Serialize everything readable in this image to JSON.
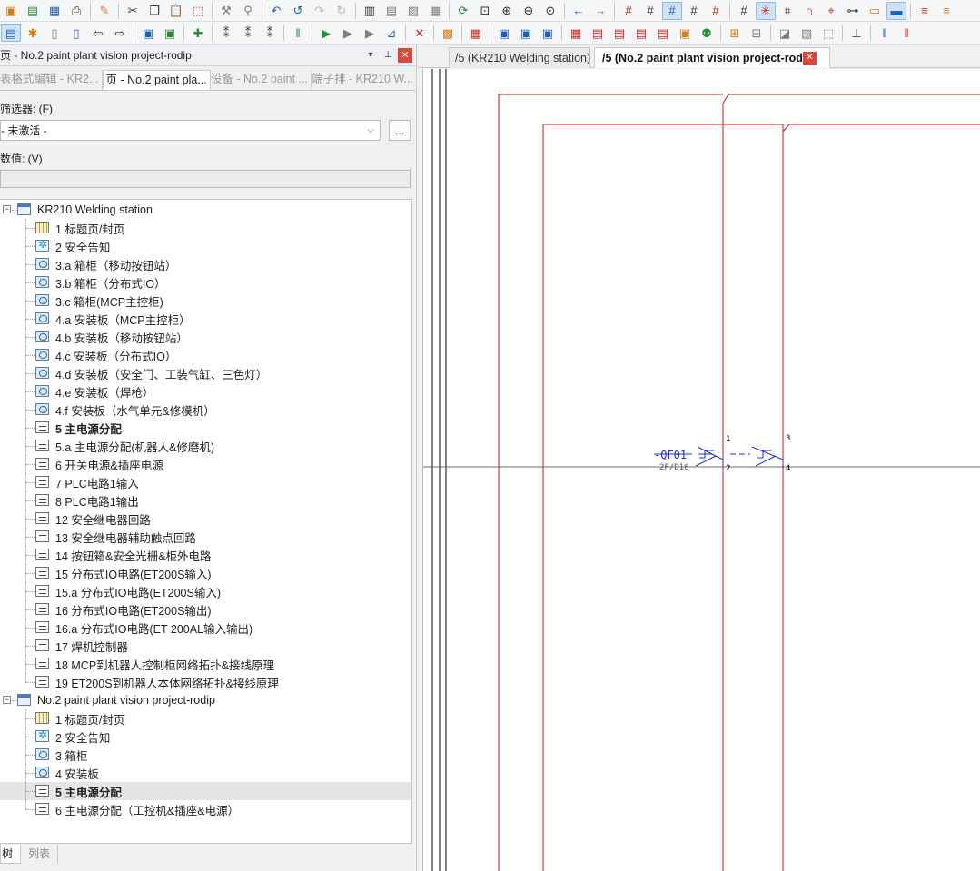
{
  "toolbar1": {
    "icons": [
      {
        "name": "new-project-icon",
        "glyph": "▣",
        "color": "c-orange"
      },
      {
        "name": "open-project-icon",
        "glyph": "▤",
        "color": "c-green"
      },
      {
        "name": "save-icon",
        "glyph": "▦",
        "color": "c-blue"
      },
      {
        "name": "print-icon",
        "glyph": "⎙",
        "color": "c-dark"
      },
      {
        "sep": true
      },
      {
        "name": "settings-wrench-icon",
        "glyph": "✎",
        "color": "c-orange"
      },
      {
        "sep": true
      },
      {
        "name": "cut-icon",
        "glyph": "✂",
        "color": "c-dark"
      },
      {
        "name": "copy-icon",
        "glyph": "❐",
        "color": "c-dark"
      },
      {
        "name": "paste-icon",
        "glyph": "📋",
        "color": "c-orange"
      },
      {
        "name": "delete-selection-icon",
        "glyph": "⬚",
        "color": "c-red"
      },
      {
        "sep": true
      },
      {
        "name": "format-paint-icon",
        "glyph": "⚒",
        "color": "c-gray"
      },
      {
        "name": "brush-icon",
        "glyph": "⚲",
        "color": "c-gray"
      },
      {
        "sep": true
      },
      {
        "name": "undo-icon",
        "glyph": "↶",
        "color": "c-blue"
      },
      {
        "name": "undo-list-icon",
        "glyph": "↺",
        "color": "c-blue"
      },
      {
        "name": "redo-icon",
        "glyph": "↷",
        "color": "c-lgray"
      },
      {
        "name": "redo-list-icon",
        "glyph": "↻",
        "color": "c-lgray"
      },
      {
        "sep": true
      },
      {
        "name": "page-layout-icon",
        "glyph": "▥",
        "color": "c-dark"
      },
      {
        "name": "page-copy-icon",
        "glyph": "▤",
        "color": "c-gray"
      },
      {
        "name": "page-properties-icon",
        "glyph": "▨",
        "color": "c-gray"
      },
      {
        "name": "table-icon",
        "glyph": "▦",
        "color": "c-gray"
      },
      {
        "sep": true
      },
      {
        "name": "refresh-icon",
        "glyph": "⟳",
        "color": "c-green"
      },
      {
        "name": "zoom-window-icon",
        "glyph": "⊡",
        "color": "c-dark"
      },
      {
        "name": "zoom-in-icon",
        "glyph": "⊕",
        "color": "c-dark"
      },
      {
        "name": "zoom-out-icon",
        "glyph": "⊖",
        "color": "c-dark"
      },
      {
        "name": "zoom-100-icon",
        "glyph": "⊙",
        "color": "c-dark"
      },
      {
        "sep": true
      },
      {
        "name": "back-arrow-icon",
        "glyph": "←",
        "color": "c-blue"
      },
      {
        "name": "forward-arrow-icon",
        "glyph": "→",
        "color": "c-gray"
      },
      {
        "sep": true
      },
      {
        "name": "grid-a-icon",
        "glyph": "#",
        "color": "c-red"
      },
      {
        "name": "grid-b-icon",
        "glyph": "#",
        "color": "c-dark"
      },
      {
        "name": "grid-c-icon",
        "glyph": "#",
        "color": "c-blue",
        "active": true
      },
      {
        "name": "grid-d-icon",
        "glyph": "#",
        "color": "c-dark"
      },
      {
        "name": "grid-e-icon",
        "glyph": "#",
        "color": "c-red"
      },
      {
        "sep": true
      },
      {
        "name": "snap-grid-icon",
        "glyph": "#",
        "color": "c-dark"
      },
      {
        "name": "snap-object-icon",
        "glyph": "✳",
        "color": "c-red",
        "active": true
      },
      {
        "name": "intersection-icon",
        "glyph": "⌗",
        "color": "c-dark"
      },
      {
        "name": "magnet-icon",
        "glyph": "∩",
        "color": "c-red"
      },
      {
        "name": "input-assist-icon",
        "glyph": "⌖",
        "color": "c-red"
      },
      {
        "name": "connection-icon",
        "glyph": "⊶",
        "color": "c-dark"
      },
      {
        "name": "label-icon",
        "glyph": "▭",
        "color": "c-orange"
      },
      {
        "name": "ortho-icon",
        "glyph": "▬",
        "color": "c-blue",
        "active": true
      },
      {
        "sep": true
      },
      {
        "name": "wires-icon",
        "glyph": "≡",
        "color": "c-red"
      },
      {
        "name": "more-icon",
        "glyph": "≡",
        "color": "c-orange"
      }
    ]
  },
  "toolbar2": {
    "icons": [
      {
        "name": "page-navigator-icon",
        "glyph": "▤",
        "color": "c-blue",
        "active": true
      },
      {
        "name": "new-page-icon",
        "glyph": "✱",
        "color": "c-orange"
      },
      {
        "name": "page-icon",
        "glyph": "▯",
        "color": "c-gray"
      },
      {
        "name": "page-edit-icon",
        "glyph": "▯",
        "color": "c-blue"
      },
      {
        "name": "previous-page-icon",
        "glyph": "⇦",
        "color": "c-dark"
      },
      {
        "name": "next-page-icon",
        "glyph": "⇨",
        "color": "c-dark"
      },
      {
        "sep": true
      },
      {
        "name": "layout-a-icon",
        "glyph": "▣",
        "color": "c-blue"
      },
      {
        "name": "layout-b-icon",
        "glyph": "▣",
        "color": "c-green"
      },
      {
        "sep": true
      },
      {
        "name": "plugin-icon",
        "glyph": "✚",
        "color": "c-green"
      },
      {
        "sep": true
      },
      {
        "name": "numbering-a-icon",
        "glyph": "⁑",
        "color": "c-dark"
      },
      {
        "name": "numbering-b-icon",
        "glyph": "⁑",
        "color": "c-dark"
      },
      {
        "name": "numbering-c-icon",
        "glyph": "⁑",
        "color": "c-dark"
      },
      {
        "sep": true
      },
      {
        "name": "insert-bar-icon",
        "glyph": "‖",
        "color": "c-green"
      },
      {
        "sep": true
      },
      {
        "name": "macro-a-icon",
        "glyph": "▶",
        "color": "c-green"
      },
      {
        "name": "macro-b-icon",
        "glyph": "▶",
        "color": "c-gray"
      },
      {
        "name": "macro-c-icon",
        "glyph": "▶",
        "color": "c-gray"
      },
      {
        "name": "plc-icon",
        "glyph": "⊿",
        "color": "c-blue"
      },
      {
        "sep": true
      },
      {
        "name": "macro-delete-icon",
        "glyph": "✕",
        "color": "c-red"
      },
      {
        "sep": true
      },
      {
        "name": "terminal-icon",
        "glyph": "▩",
        "color": "c-orange"
      },
      {
        "sep": true
      },
      {
        "name": "cabinet-icon",
        "glyph": "▦",
        "color": "c-red"
      },
      {
        "sep": true
      },
      {
        "name": "component-a-icon",
        "glyph": "▣",
        "color": "c-blue"
      },
      {
        "name": "component-b-icon",
        "glyph": "▣",
        "color": "c-blue"
      },
      {
        "name": "component-c-icon",
        "glyph": "▣",
        "color": "c-blue"
      },
      {
        "sep": true
      },
      {
        "name": "device-a-icon",
        "glyph": "▦",
        "color": "c-red"
      },
      {
        "name": "device-b-icon",
        "glyph": "▤",
        "color": "c-red"
      },
      {
        "name": "device-c-icon",
        "glyph": "▤",
        "color": "c-red"
      },
      {
        "name": "device-d-icon",
        "glyph": "▤",
        "color": "c-red"
      },
      {
        "name": "device-e-icon",
        "glyph": "▤",
        "color": "c-red"
      },
      {
        "name": "device-f-icon",
        "glyph": "▣",
        "color": "c-orange"
      },
      {
        "name": "network-icon",
        "glyph": "⚉",
        "color": "c-green"
      },
      {
        "sep": true
      },
      {
        "name": "connector-a-icon",
        "glyph": "⊞",
        "color": "c-orange"
      },
      {
        "name": "connector-b-icon",
        "glyph": "⊟",
        "color": "c-gray"
      },
      {
        "sep": true
      },
      {
        "name": "shape-a-icon",
        "glyph": "◪",
        "color": "c-gray"
      },
      {
        "name": "hatch-icon",
        "glyph": "▧",
        "color": "c-gray"
      },
      {
        "name": "shape-c-icon",
        "glyph": "⬚",
        "color": "c-gray"
      },
      {
        "sep": true
      },
      {
        "name": "dimension-icon",
        "glyph": "⊥",
        "color": "c-dark"
      },
      {
        "sep": true
      },
      {
        "name": "wire-marker-icon",
        "glyph": "‖",
        "color": "c-blue"
      },
      {
        "name": "wire-more-icon",
        "glyph": "‖",
        "color": "c-red"
      }
    ]
  },
  "panel": {
    "title": "页 - No.2 paint plant vision project-rodip",
    "pin_glyph": "▾",
    "dock_glyph": "⊥",
    "close_glyph": "✕",
    "tabs": [
      "表格式编辑 - KR2...",
      "页 - No.2 paint pla...",
      "设备 - No.2 paint ...",
      "端子排 - KR210 W..."
    ],
    "active_tab": 1,
    "filter_label": "筛选器: (F)",
    "filter_value": "- 未激活 -",
    "filter_more": "...",
    "value_label": "数值: (V)",
    "value_input": "",
    "bottom_tabs": [
      "树",
      "列表"
    ]
  },
  "tree": [
    {
      "label": "KR210 Welding station",
      "level": 0,
      "icon": "book",
      "expander": "−"
    },
    {
      "label": "1 标题页/封页",
      "level": 1,
      "icon": "grid"
    },
    {
      "label": "2 安全告知",
      "level": 1,
      "icon": "star"
    },
    {
      "label": "3.a 箱柜（移动按钮站）",
      "level": 1,
      "icon": "lay"
    },
    {
      "label": "3.b 箱柜（分布式IO）",
      "level": 1,
      "icon": "lay"
    },
    {
      "label": "3.c 箱柜(MCP主控柜)",
      "level": 1,
      "icon": "lay"
    },
    {
      "label": "4.a 安装板（MCP主控柜）",
      "level": 1,
      "icon": "lay"
    },
    {
      "label": "4.b 安装板（移动按钮站）",
      "level": 1,
      "icon": "lay"
    },
    {
      "label": "4.c 安装板（分布式IO）",
      "level": 1,
      "icon": "lay"
    },
    {
      "label": "4.d 安装板（安全门、工装气缸、三色灯）",
      "level": 1,
      "icon": "lay"
    },
    {
      "label": "4.e 安装板（焊枪）",
      "level": 1,
      "icon": "lay"
    },
    {
      "label": "4.f 安装板（水气单元&修模机）",
      "level": 1,
      "icon": "lay"
    },
    {
      "label": "5 主电源分配",
      "level": 1,
      "icon": "sch",
      "bold": true
    },
    {
      "label": "5.a 主电源分配(机器人&修磨机)",
      "level": 1,
      "icon": "sch"
    },
    {
      "label": "6 开关电源&插座电源",
      "level": 1,
      "icon": "sch"
    },
    {
      "label": "7 PLC电路1输入",
      "level": 1,
      "icon": "sch"
    },
    {
      "label": "8 PLC电路1输出",
      "level": 1,
      "icon": "sch"
    },
    {
      "label": "12 安全继电器回路",
      "level": 1,
      "icon": "sch"
    },
    {
      "label": "13 安全继电器辅助触点回路",
      "level": 1,
      "icon": "sch"
    },
    {
      "label": "14 按钮箱&安全光栅&柜外电路",
      "level": 1,
      "icon": "sch"
    },
    {
      "label": "15 分布式IO电路(ET200S输入)",
      "level": 1,
      "icon": "sch"
    },
    {
      "label": "15.a 分布式IO电路(ET200S输入)",
      "level": 1,
      "icon": "sch"
    },
    {
      "label": "16 分布式IO电路(ET200S输出)",
      "level": 1,
      "icon": "sch"
    },
    {
      "label": "16.a 分布式IO电路(ET 200AL输入输出)",
      "level": 1,
      "icon": "sch"
    },
    {
      "label": "17 焊机控制器",
      "level": 1,
      "icon": "sch"
    },
    {
      "label": "18 MCP到机器人控制柜网络拓扑&接线原理",
      "level": 1,
      "icon": "sch"
    },
    {
      "label": "19 ET200S到机器人本体网络拓扑&接线原理",
      "level": 1,
      "icon": "sch"
    },
    {
      "label": "No.2 paint plant vision project-rodip",
      "level": 0,
      "icon": "book",
      "expander": "−"
    },
    {
      "label": "1 标题页/封页",
      "level": 1,
      "icon": "grid"
    },
    {
      "label": "2 安全告知",
      "level": 1,
      "icon": "star"
    },
    {
      "label": "3 箱柜",
      "level": 1,
      "icon": "lay"
    },
    {
      "label": "4 安装板",
      "level": 1,
      "icon": "lay"
    },
    {
      "label": "5 主电源分配",
      "level": 1,
      "icon": "sch",
      "bold": true,
      "selected": true
    },
    {
      "label": "6 主电源分配（工控机&插座&电源）",
      "level": 1,
      "icon": "sch"
    }
  ],
  "doc_tabs": {
    "tab1": "/5 (KR210 Welding station)",
    "tab2": "/5 (No.2 paint plant vision project-rodip)",
    "close_glyph": "✕"
  },
  "schematic": {
    "device_tag": "-QF01",
    "device_ref": "2F/D16",
    "pin_1": "1",
    "pin_2": "2",
    "pin_3": "3",
    "pin_4": "4",
    "frame_color": "#c8161d",
    "symbol_color": "#1c2fd6"
  }
}
